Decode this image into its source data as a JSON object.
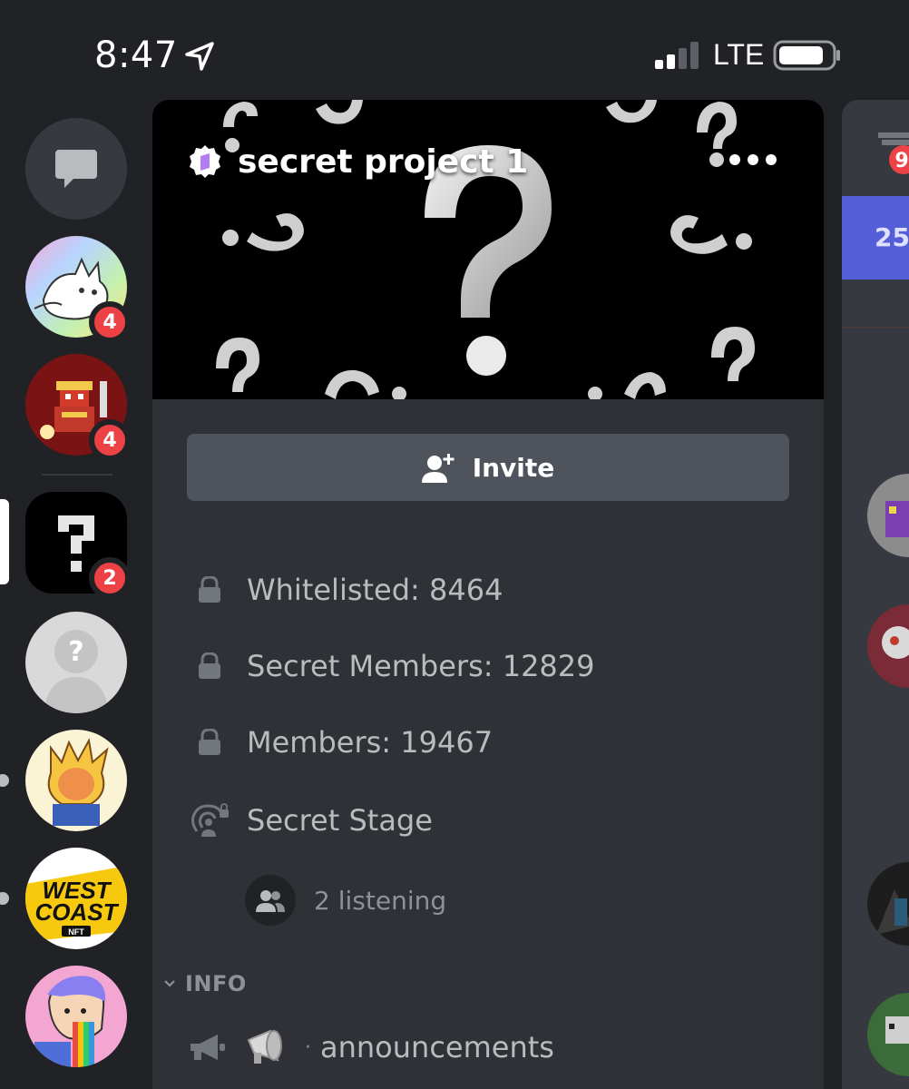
{
  "status_bar": {
    "time": "8:47",
    "network": "LTE"
  },
  "guild_rail": {
    "guilds": [
      {
        "name": "direct-messages"
      },
      {
        "badge": "4"
      },
      {
        "badge": "4"
      },
      {
        "badge": "2",
        "selected": true
      },
      {},
      {},
      {
        "text": "WEST COAST",
        "subtext": "NFT"
      },
      {}
    ]
  },
  "server": {
    "name": "secret project 1",
    "invite_label": "Invite",
    "channels": [
      {
        "label": "Whitelisted: 8464",
        "icon": "lock-icon"
      },
      {
        "label": "Secret Members: 12829",
        "icon": "lock-icon"
      },
      {
        "label": "Members: 19467",
        "icon": "lock-icon"
      },
      {
        "label": "Secret Stage",
        "icon": "stage-icon"
      }
    ],
    "stage_listening": "2 listening",
    "category": "INFO",
    "announcements": {
      "separator": "·",
      "label": "announcements"
    }
  },
  "peek": {
    "counter": "9",
    "blue_text": "25"
  },
  "colors": {
    "background": "#202225",
    "panel": "#2f3136",
    "badge": "#ed4245",
    "blurple": "#5865f2",
    "button": "#4f545c"
  }
}
